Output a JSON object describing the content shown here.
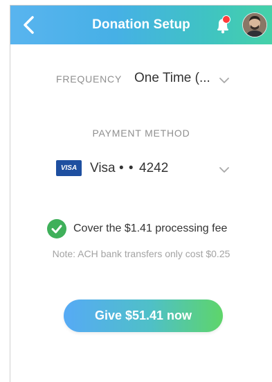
{
  "header": {
    "title": "Donation Setup",
    "back_icon": "chevron-left-icon",
    "bell_icon": "bell-icon",
    "avatar_icon": "user-avatar",
    "gradient_start": "#59b4ef",
    "gradient_end": "#45d1a8",
    "notification_dot_color": "#ff3b3b"
  },
  "frequency": {
    "label": "FREQUENCY",
    "value": "One Time (...",
    "dropdown_icon": "chevron-down-icon"
  },
  "payment": {
    "label": "PAYMENT METHOD",
    "card_brand_badge": "VISA",
    "card_name": "Visa",
    "card_mask": "• •",
    "card_last4": "4242",
    "badge_color": "#1e4fa0",
    "dropdown_icon": "chevron-down-icon"
  },
  "fee": {
    "checked": true,
    "text": "Cover the $1.41 processing fee",
    "check_icon": "check-circle-icon",
    "check_color": "#3fb05a"
  },
  "note": {
    "text": "Note: ACH bank transfers only cost $0.25"
  },
  "give_button": {
    "label": "Give $51.41 now",
    "gradient_start": "#56aaf5",
    "gradient_end": "#5ed56a"
  }
}
